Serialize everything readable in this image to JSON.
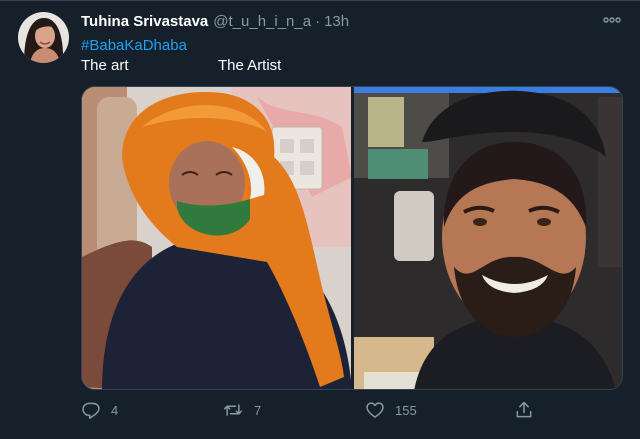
{
  "tweet": {
    "author_name": "Tuhina Srivastava",
    "handle": "@t_u_h_i_n_a",
    "separator": "·",
    "time": "13h",
    "hashtag": "#BabaKaDhaba",
    "caption_left": "The art",
    "caption_right": "The Artist"
  },
  "actions": {
    "reply_count": "4",
    "retweet_count": "7",
    "like_count": "155"
  },
  "icons": {
    "reply": "reply-icon",
    "retweet": "retweet-icon",
    "like": "heart-icon",
    "share": "share-icon",
    "more": "more-icon"
  },
  "colors": {
    "background": "#15202b",
    "link": "#1da1f2",
    "secondary_text": "#8899a6",
    "border": "#38444d"
  }
}
